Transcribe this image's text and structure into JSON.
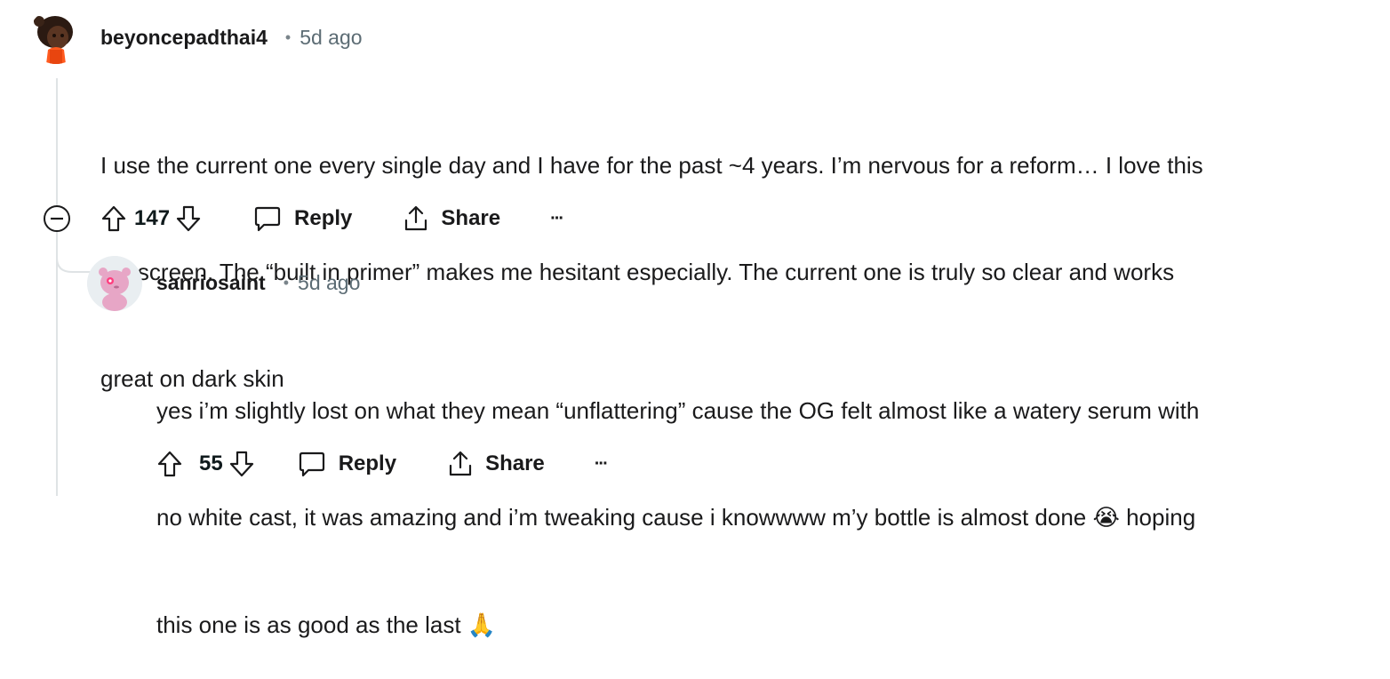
{
  "comments": [
    {
      "username": "beyoncepadthai4",
      "separator": "•",
      "time": "5d ago",
      "body_lines": [
        "I use the current one every single day and I have for the past ~4 years. I’m nervous for a reform… I love this",
        "sunscreen. The “built in primer” makes me hesitant especially. The current one is truly so clear and works",
        "great on dark skin"
      ],
      "votes": "147",
      "reply_label": "Reply",
      "share_label": "Share",
      "more_label": "···"
    },
    {
      "username": "sanriosaint",
      "separator": "•",
      "time": "5d ago",
      "body_lines": [
        "yes i’m slightly lost on what they mean “unflattering” cause the OG felt almost like a watery serum with",
        "no white cast, it was amazing and i’m tweaking cause i knowwww m’y bottle is almost done",
        "hoping",
        "this one is as good as the last"
      ],
      "emoji_crying": "😭",
      "emoji_pray": "🙏",
      "votes": "55",
      "reply_label": "Reply",
      "share_label": "Share",
      "more_label": "···"
    }
  ],
  "colors": {
    "thread_line": "#dfe3e5",
    "text": "#1a1a1b",
    "meta": "#5c6c74",
    "avatar1_bg": "#f2f4f5",
    "avatar2_bg": "#e9eef1"
  }
}
